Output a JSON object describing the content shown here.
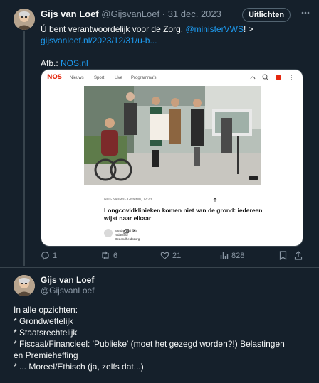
{
  "tweet1": {
    "author_name": "Gijs van Loef",
    "handle": "@GijsvanLoef",
    "date_separator": " · ",
    "date": "31 dec. 2023",
    "unfollow_label": "Uitlichten",
    "more_icon": "ellipsis-icon",
    "text_line1_prefix": "Ú bent verantwoordelijk voor de Zorg, ",
    "text_line1_mention": "@ministerVWS",
    "text_line1_suffix": "! >",
    "text_line2_link": "gijsvanloef.nl/2023/12/31/u-b...",
    "text_line3_prefix": "Afb.: ",
    "text_line3_link": "NOS.nl",
    "card": {
      "logo": "NOS",
      "nav": [
        "Nieuws",
        "Sport",
        "Live",
        "Programma's"
      ],
      "source": "NOS Nieuws · Gisteren, 12:23",
      "headline": "Longcovidklinieken komen niet van de grond: iedereen wijst naar elkaar",
      "author_name": "Sandra Zuthoke",
      "author_role1": "redacteur",
      "author_role2": "Gezondheidszorg",
      "x_label": "X"
    },
    "actions": {
      "reply_count": "1",
      "retweet_count": "6",
      "like_count": "21",
      "views_count": "828"
    }
  },
  "tweet2": {
    "author_name": "Gijs van Loef",
    "handle": "@GijsvanLoef",
    "lines": [
      "In alle opzichten:",
      "* Grondwettelijk",
      "* Staatsrechtelijk",
      "* Fiscaal/Financieel: 'Publieke' (moet het gezegd worden?!) Belastingen",
      "en Premieheffing",
      "* ... Moreel/Ethisch (ja, zelfs dat...)"
    ]
  },
  "colors": {
    "background": "#15202b",
    "text": "#f7f9f9",
    "muted": "#8b98a5",
    "link": "#1d9bf0",
    "border": "#38444d",
    "nos_red": "#e5270e"
  }
}
